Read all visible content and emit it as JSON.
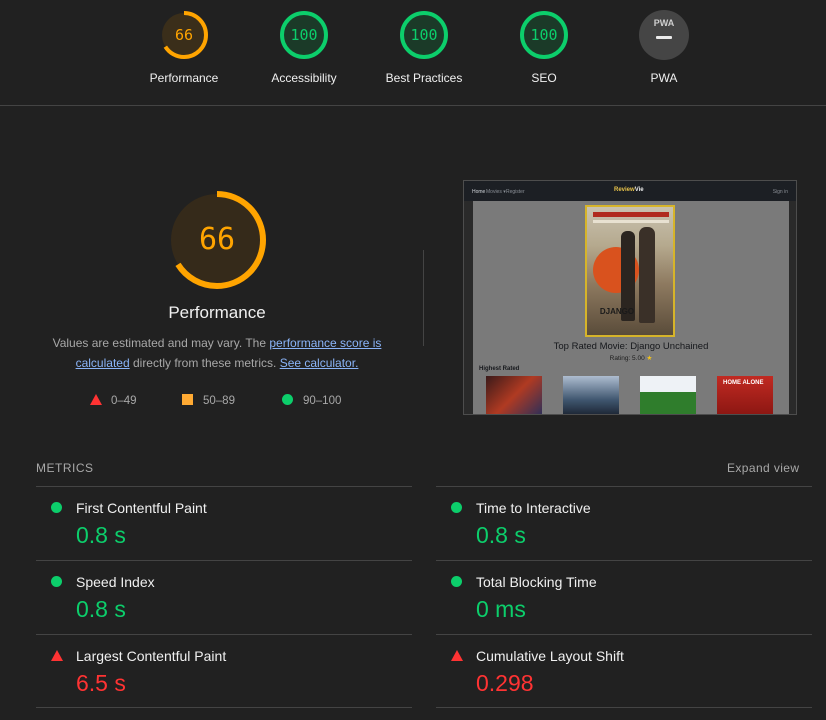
{
  "summary": {
    "gauges": [
      {
        "score": "66",
        "label": "Performance",
        "color": "#ffa400",
        "fraction": 0.66
      },
      {
        "score": "100",
        "label": "Accessibility",
        "color": "#0cce6b",
        "fraction": 1.0
      },
      {
        "score": "100",
        "label": "Best Practices",
        "color": "#0cce6b",
        "fraction": 1.0
      },
      {
        "score": "100",
        "label": "SEO",
        "color": "#0cce6b",
        "fraction": 1.0
      }
    ],
    "pwa": {
      "badge": "PWA",
      "label": "PWA"
    }
  },
  "performance": {
    "score": "66",
    "fraction": 0.66,
    "title": "Performance",
    "desc_prefix": "Values are estimated and may vary. The ",
    "desc_link1": "performance score is calculated",
    "desc_middle": " directly from these metrics. ",
    "desc_link2": "See calculator.",
    "legend": {
      "fail": "0–49",
      "average": "50–89",
      "pass": "90–100"
    }
  },
  "screenshot": {
    "nav_home": "Home",
    "nav_movies": "Movies ▾",
    "nav_register": "Register",
    "brand_prefix": "Review",
    "brand_suffix": "Vie",
    "nav_signin": "Sign in",
    "poster_title": "DJANGO",
    "top_title": "Top Rated Movie: Django Unchained",
    "rating": "Rating: 5.00",
    "highest_rated": "Highest Rated",
    "movie4_title": "HOME ALONE"
  },
  "metrics": {
    "title": "METRICS",
    "expand": "Expand view",
    "items": [
      {
        "name": "First Contentful Paint",
        "value": "0.8 s",
        "status": "pass"
      },
      {
        "name": "Time to Interactive",
        "value": "0.8 s",
        "status": "pass"
      },
      {
        "name": "Speed Index",
        "value": "0.8 s",
        "status": "pass"
      },
      {
        "name": "Total Blocking Time",
        "value": "0 ms",
        "status": "pass"
      },
      {
        "name": "Largest Contentful Paint",
        "value": "6.5 s",
        "status": "fail"
      },
      {
        "name": "Cumulative Layout Shift",
        "value": "0.298",
        "status": "fail"
      }
    ]
  },
  "colors": {
    "pass": "#0cce6b",
    "average": "#ffa400",
    "fail": "#ff3333",
    "background": "#212121"
  }
}
